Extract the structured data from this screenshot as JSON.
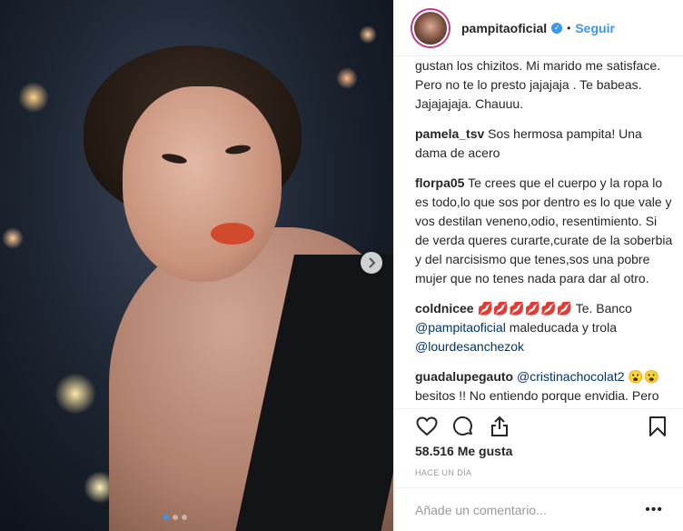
{
  "header": {
    "username": "pampitaoficial",
    "follow_label": "Seguir",
    "separator": "•"
  },
  "comments": [
    {
      "user": "",
      "text": "gustan los chizitos. Mi marido me satisface. Pero no te lo presto jajajaja . Te babeas. Jajajajaja. Chauuu."
    },
    {
      "user": "pamela_tsv",
      "text": "Sos hermosa pampita! Una dama de acero"
    },
    {
      "user": "florpa05",
      "text": "Te crees que el cuerpo y la ropa lo es todo,lo que sos por dentro es lo que vale y vos destilan veneno,odio, resentimiento. Si de verda queres curarte,curate de la soberbia y del narcisismo que tenes,sos una pobre mujer que no tenes nada para dar al otro."
    },
    {
      "user": "coldnicee",
      "text_before": "💋💋💋💋💋💋 Te. Banco ",
      "mention1": "@pampitaoficial",
      "text_middle": " maleducada y trola ",
      "mention2": "@lourdesanchezok"
    },
    {
      "user": "guadalupegauto",
      "mention": "@cristinachocolat2",
      "text": " 😮😮 besitos !! No entiendo porque envidia. Pero bueno ! Jaj se tomo el tiempo para entrar en mi perfil? Wouu !! Jajaj"
    }
  ],
  "likes": "58.516 Me gusta",
  "timestamp": "HACE UN DÍA",
  "add_comment_placeholder": "Añade un comentario...",
  "more_label": "•••",
  "icons": {
    "like": "heart-icon",
    "comment": "comment-icon",
    "share": "share-icon",
    "save": "bookmark-icon",
    "next": "chevron-right-icon",
    "verified": "verified-badge-icon"
  },
  "colors": {
    "link": "#3897f0",
    "mention": "#003569",
    "text": "#262626",
    "muted": "#999999"
  },
  "carousel": {
    "total": 3,
    "active": 1
  }
}
